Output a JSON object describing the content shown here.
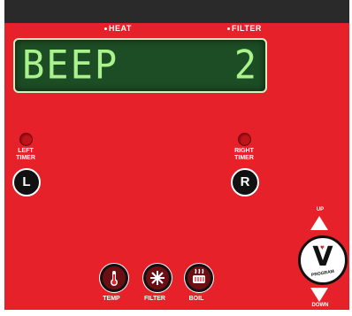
{
  "indicators": {
    "heat_label": "HEAT",
    "filter_label": "FILTER"
  },
  "display": {
    "left_text": "BEEP",
    "right_text": "2"
  },
  "timers": {
    "left_label_line1": "LEFT",
    "left_label_line2": "TIMER",
    "left_button": "L",
    "right_label_line1": "RIGHT",
    "right_label_line2": "TIMER",
    "right_button": "R"
  },
  "functions": [
    {
      "label": "TEMP",
      "icon": "thermometer-icon"
    },
    {
      "label": "FILTER",
      "icon": "filter-icon"
    },
    {
      "label": "BOIL",
      "icon": "boil-icon"
    }
  ],
  "program": {
    "up_label": "UP",
    "down_label": "DOWN",
    "button_letter": "V",
    "button_label": "PROGRAM"
  },
  "colors": {
    "panel": "#e62129",
    "display_bg": "#1d4d24",
    "display_text": "#aaf38c"
  }
}
